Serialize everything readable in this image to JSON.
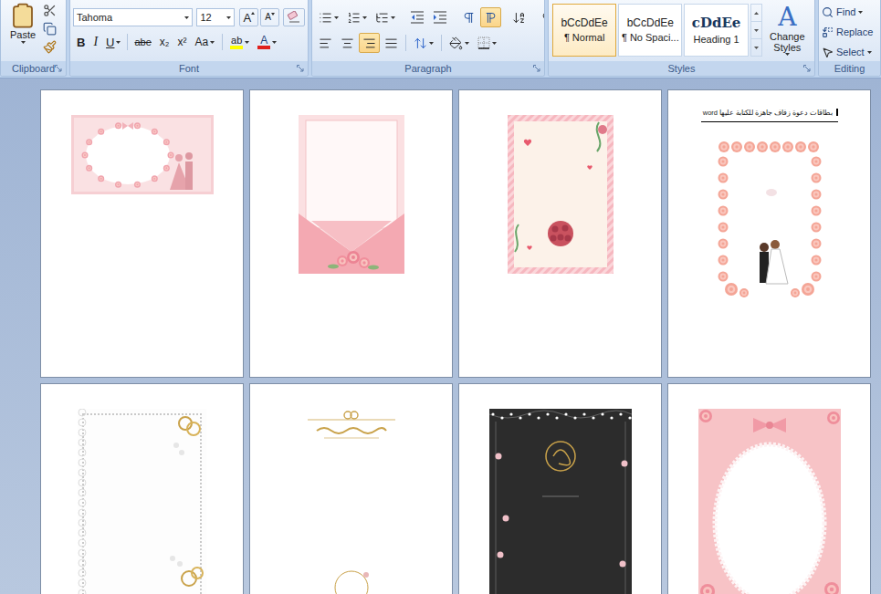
{
  "ribbon": {
    "clipboard": {
      "label": "Clipboard",
      "paste": "Paste"
    },
    "font": {
      "label": "Font",
      "name": "Tahoma",
      "size": "12",
      "grow": "A",
      "shrink": "A",
      "formatting": [
        {
          "label": "B",
          "kind": "bold",
          "dropdown": false
        },
        {
          "label": "I",
          "kind": "italic",
          "dropdown": false
        },
        {
          "label": "U",
          "kind": "underline",
          "dropdown": true
        },
        {
          "label": "abe",
          "kind": "strike",
          "dropdown": false
        },
        {
          "label": "x₂",
          "kind": "subscript",
          "dropdown": false
        },
        {
          "label": "x²",
          "kind": "superscript",
          "dropdown": false
        },
        {
          "label": "Aa",
          "kind": "case",
          "dropdown": true
        }
      ],
      "highlight": {
        "label": "ab",
        "color": "#ffff00"
      },
      "font_color": {
        "label": "A",
        "color": "#e0201c"
      }
    },
    "paragraph": {
      "label": "Paragraph",
      "row1": [
        {
          "kind": "bullets",
          "group": 1,
          "dropdown": true,
          "selected": false
        },
        {
          "kind": "numbering",
          "group": 1,
          "dropdown": true,
          "selected": false
        },
        {
          "kind": "multilevel",
          "group": 1,
          "dropdown": true,
          "selected": false
        },
        {
          "kind": "decrease-indent",
          "group": 2,
          "dropdown": false,
          "selected": false
        },
        {
          "kind": "increase-indent",
          "group": 2,
          "dropdown": false,
          "selected": false
        },
        {
          "kind": "ltr",
          "group": 3,
          "dropdown": false,
          "selected": false
        },
        {
          "kind": "rtl",
          "group": 3,
          "dropdown": false,
          "selected": true
        },
        {
          "kind": "sort",
          "group": 4,
          "dropdown": false,
          "selected": false
        },
        {
          "kind": "show-marks",
          "group": 5,
          "dropdown": false,
          "selected": false
        }
      ],
      "row2": [
        {
          "kind": "align-left",
          "group": 1,
          "dropdown": false,
          "selected": false
        },
        {
          "kind": "align-center",
          "group": 1,
          "dropdown": false,
          "selected": false
        },
        {
          "kind": "align-right",
          "group": 1,
          "dropdown": false,
          "selected": true
        },
        {
          "kind": "justify",
          "group": 1,
          "dropdown": false,
          "selected": false
        },
        {
          "kind": "line-spacing",
          "group": 2,
          "dropdown": true,
          "selected": false
        },
        {
          "kind": "shading",
          "group": 3,
          "dropdown": true,
          "selected": false
        },
        {
          "kind": "borders",
          "group": 3,
          "dropdown": true,
          "selected": false
        }
      ]
    },
    "styles": {
      "label": "Styles",
      "items": [
        {
          "sample": "bCcDdEe",
          "name": "¶ Normal",
          "kind": "normal",
          "selected": true
        },
        {
          "sample": "bCcDdEe",
          "name": "¶ No Spaci...",
          "kind": "normal",
          "selected": false
        },
        {
          "sample": "cDdEe",
          "name": "Heading 1",
          "kind": "heading",
          "selected": false
        }
      ],
      "change": {
        "icon": "A",
        "label": "Change Styles"
      }
    },
    "editing": {
      "label": "Editing",
      "items": [
        {
          "label": "Find",
          "kind": "find",
          "dropdown": true
        },
        {
          "label": "Replace",
          "kind": "replace",
          "dropdown": false
        },
        {
          "label": "Select",
          "kind": "select",
          "dropdown": true
        }
      ]
    }
  },
  "pages": [
    {
      "card": {
        "kind": "couple-wide",
        "color": "#f6cfd3"
      }
    },
    {
      "card": {
        "kind": "envelope",
        "color": "#fbe0e2"
      }
    },
    {
      "card": {
        "kind": "ribbon-bouquet",
        "color": "#f6b7bf"
      }
    },
    {
      "heading": "بطاقات دعوة زفاف جاهزة للكتابة عليها word",
      "card": {
        "kind": "couple-floral",
        "color": "#f4a596"
      }
    },
    {
      "card": {
        "kind": "lace",
        "color": "#c9c9c9"
      }
    },
    {
      "card": {
        "kind": "gold-minimal",
        "color": "#c9a24a"
      }
    },
    {
      "card": {
        "kind": "dark-lights",
        "color": "#2c2c2c"
      }
    },
    {
      "card": {
        "kind": "oval-frame",
        "color": "#f7c3c6"
      }
    }
  ]
}
